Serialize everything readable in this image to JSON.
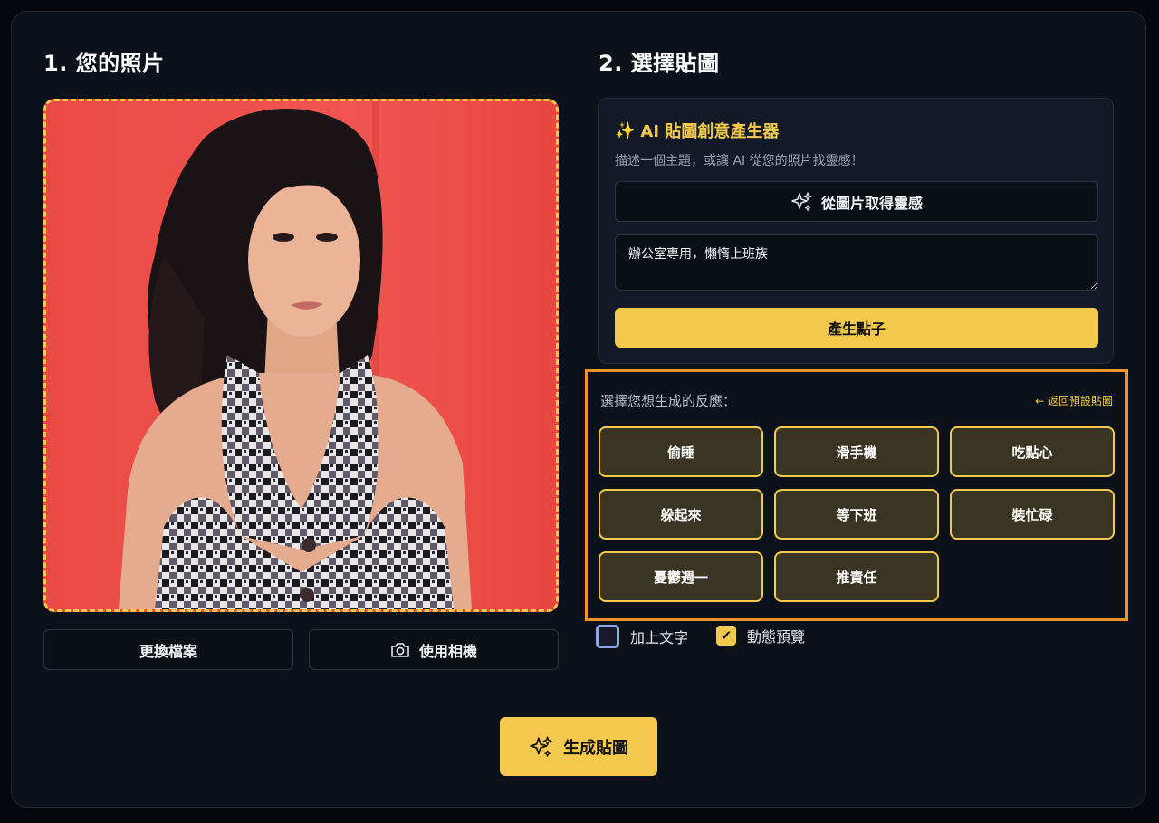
{
  "section1": {
    "title": "1. 您的照片"
  },
  "section2": {
    "title": "2. 選擇貼圖"
  },
  "photo": {
    "alt": "Uploaded photo",
    "buttons": {
      "replace_label": "更換檔案",
      "camera_label": "使用相機"
    }
  },
  "ai_generator": {
    "title": "AI 貼圖創意產生器",
    "title_icon": "✨",
    "description": "描述一個主題，或讓 AI 從您的照片找靈感！",
    "inspire_label": "從圖片取得靈感",
    "idea_value": "辦公室專用，懶惰上班族",
    "generate_ideas_label": "產生點子"
  },
  "reactions": {
    "label": "選擇您想生成的反應：",
    "back_link": "← 返回預設貼圖",
    "items": [
      "偷睡",
      "滑手機",
      "吃點心",
      "躲起來",
      "等下班",
      "裝忙碌",
      "憂鬱週一",
      "推責任"
    ]
  },
  "options": {
    "add_text_label": "加上文字",
    "add_text_checked": false,
    "animated_preview_label": "動態預覽",
    "animated_preview_checked": true
  },
  "generate_button": {
    "label": "生成貼圖"
  },
  "colors": {
    "accent": "#f2c94c",
    "highlight": "#f0922e",
    "background": "#0d1119"
  }
}
